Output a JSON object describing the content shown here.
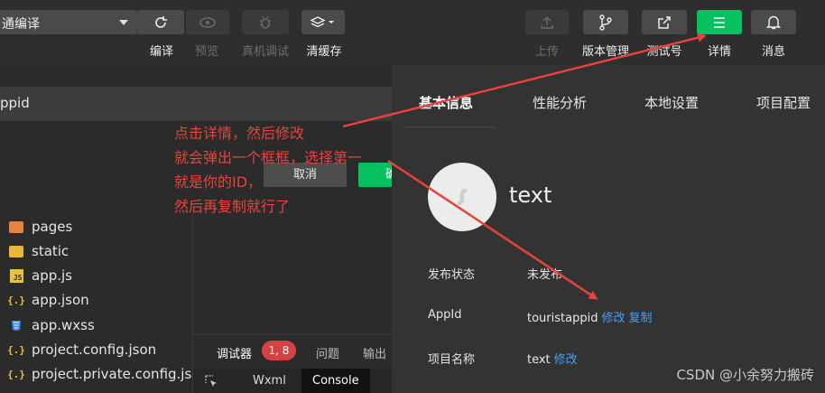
{
  "toolbar": {
    "mode_select": "通编译",
    "buttons": [
      {
        "label": "编译",
        "icon": "refresh-icon"
      },
      {
        "label": "预览",
        "icon": "eye-icon"
      },
      {
        "label": "真机调试",
        "icon": "bug-icon"
      },
      {
        "label": "清缓存",
        "icon": "layers-icon"
      },
      {
        "label": "上传",
        "icon": "upload-icon"
      },
      {
        "label": "版本管理",
        "icon": "branch-icon"
      },
      {
        "label": "测试号",
        "icon": "external-link-icon"
      },
      {
        "label": "详情",
        "icon": "menu-icon"
      },
      {
        "label": "消息",
        "icon": "bell-icon"
      }
    ]
  },
  "left_panel": {
    "appid_row": "ppid",
    "cancel_label": "取消",
    "confirm_label": "确定",
    "file_tree": [
      {
        "name": "pages",
        "icon": "folder-icon"
      },
      {
        "name": "static",
        "icon": "folder-icon"
      },
      {
        "name": "app.js",
        "icon": "js-file-icon"
      },
      {
        "name": "app.json",
        "icon": "json-file-icon"
      },
      {
        "name": "app.wxss",
        "icon": "css-file-icon"
      },
      {
        "name": "project.config.json",
        "icon": "json-file-icon"
      },
      {
        "name": "project.private.config.js...",
        "icon": "json-file-icon"
      }
    ]
  },
  "debugger": {
    "tabs": [
      "调试器",
      "问题",
      "输出"
    ],
    "badge": "1, 8",
    "sub_tabs": [
      "Wxml",
      "Console"
    ]
  },
  "detail_panel": {
    "tabs": [
      "基本信息",
      "性能分析",
      "本地设置",
      "项目配置"
    ],
    "app_name": "text",
    "rows": [
      {
        "label": "发布状态",
        "value": "未发布",
        "links": []
      },
      {
        "label": "AppId",
        "value": "touristappid",
        "links": [
          "修改",
          "复制"
        ]
      },
      {
        "label": "项目名称",
        "value": "text",
        "links": [
          "修改"
        ]
      }
    ]
  },
  "annotation": {
    "lines": [
      "点击详情，然后修改",
      "就会弹出一个框框，选择第一",
      "就是你的ID，",
      "然后再复制就行了"
    ],
    "color": "#e8423f"
  },
  "watermark": "CSDN @小余努力搬砖",
  "colors": {
    "accent_green": "#07c160",
    "link_blue": "#4a9ff5",
    "badge_red": "#d64141"
  }
}
